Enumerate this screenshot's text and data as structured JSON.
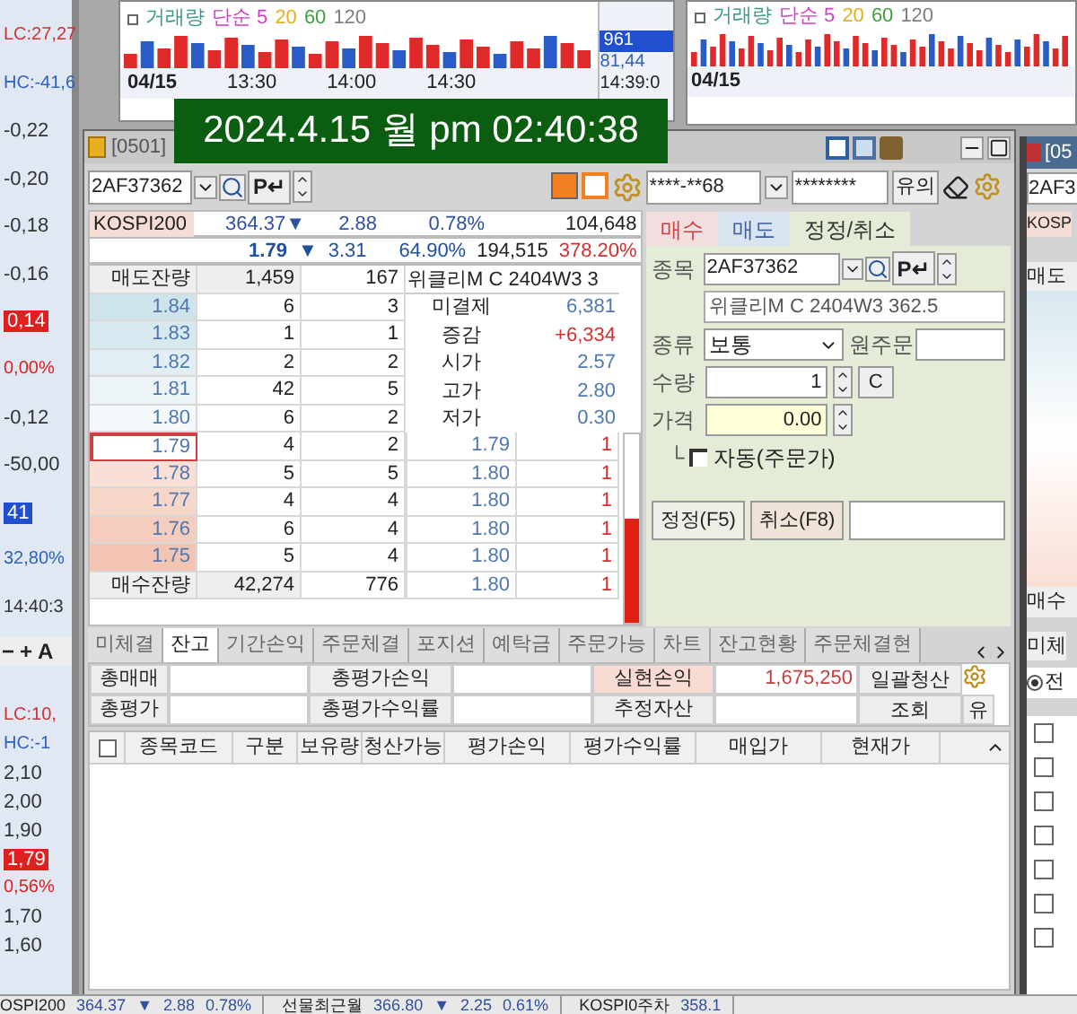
{
  "left_axis": {
    "upper": [
      {
        "text": "LC:27,27",
        "kind": "lc"
      },
      {
        "text": "HC:-41,6",
        "kind": "hc"
      },
      {
        "text": "-0,22",
        "kind": "tick"
      },
      {
        "text": "-0,20",
        "kind": "tick"
      },
      {
        "text": "-0,18",
        "kind": "tick"
      },
      {
        "text": "-0,16",
        "kind": "tick"
      },
      {
        "text": "0,14",
        "kind": "redtag"
      },
      {
        "text": "0,00%",
        "kind": "redpct"
      },
      {
        "text": "-0,12",
        "kind": "tick"
      },
      {
        "text": "-50,00",
        "kind": "tick"
      },
      {
        "text": "41",
        "kind": "bluetag"
      },
      {
        "text": "32,80%",
        "kind": "bluepct"
      },
      {
        "text": "14:40:3",
        "kind": "time"
      }
    ],
    "toolbar": [
      "−",
      "+",
      "A"
    ],
    "lower": [
      {
        "text": "LC:10,",
        "kind": "lc"
      },
      {
        "text": "HC:-1",
        "kind": "hc"
      },
      {
        "text": "2,10",
        "kind": "tick"
      },
      {
        "text": "2,00",
        "kind": "tick"
      },
      {
        "text": "1,90",
        "kind": "tick"
      },
      {
        "text": "1,79",
        "kind": "redtag"
      },
      {
        "text": "0,56%",
        "kind": "redpct"
      },
      {
        "text": "1,70",
        "kind": "tick"
      },
      {
        "text": "1,60",
        "kind": "tick"
      }
    ]
  },
  "chart_left": {
    "legend": [
      {
        "text": "거래량",
        "color": "#3a9a8a"
      },
      {
        "text": "단순 5",
        "color": "#d040c0"
      },
      {
        "text": "20",
        "color": "#e0b020"
      },
      {
        "text": "60",
        "color": "#40a040"
      },
      {
        "text": "120",
        "color": "#808080"
      }
    ],
    "date": "04/15",
    "times": [
      "13:30",
      "14:00",
      "14:30"
    ],
    "axis": {
      "tag": "961",
      "value": "81,44",
      "time": "14:39:0"
    }
  },
  "chart_right": {
    "legend": [
      {
        "text": "거래량",
        "color": "#3a9a8a"
      },
      {
        "text": "단순 5",
        "color": "#d040c0"
      },
      {
        "text": "20",
        "color": "#e0b020"
      },
      {
        "text": "60",
        "color": "#40a040"
      },
      {
        "text": "120",
        "color": "#808080"
      }
    ],
    "date": "04/15"
  },
  "clock": "2024.4.15 월 pm 02:40:38",
  "main_window": {
    "title": "[0501]",
    "code": "2AF37362",
    "p_label": "P↵",
    "index_row": {
      "name": "KOSPI200",
      "value": "364.37",
      "arrow": "▼",
      "change": "2.88",
      "rate": "0.78%",
      "volume": "104,648"
    },
    "price_row": {
      "price": "1.79",
      "arrow": "▼",
      "change": "3.31",
      "rate": "64.90%",
      "volume": "194,515",
      "ratio": "378.20%"
    },
    "ask_header": {
      "label": "매도잔량",
      "qty": "1,459",
      "count": "167",
      "name": "위클리M C 2404W3 3"
    },
    "asks": [
      {
        "price": "1.84",
        "qty": "6",
        "count": "3",
        "label": "미결제",
        "value": "6,381",
        "kind": "plain"
      },
      {
        "price": "1.83",
        "qty": "1",
        "count": "1",
        "label": "증감",
        "value": "+6,334",
        "kind": "up"
      },
      {
        "price": "1.82",
        "qty": "2",
        "count": "2",
        "label": "시가",
        "value": "2.57",
        "kind": "plain"
      },
      {
        "price": "1.81",
        "qty": "42",
        "count": "5",
        "label": "고가",
        "value": "2.80",
        "kind": "plain"
      },
      {
        "price": "1.80",
        "qty": "6",
        "count": "2",
        "label": "저가",
        "value": "0.30",
        "kind": "plain"
      }
    ],
    "bids": [
      {
        "price": "1.79",
        "qty": "4",
        "count": "2",
        "trade_price": "1.79",
        "trade_qty": "1",
        "selected": true
      },
      {
        "price": "1.78",
        "qty": "5",
        "count": "5",
        "trade_price": "1.80",
        "trade_qty": "1",
        "selected": false
      },
      {
        "price": "1.77",
        "qty": "4",
        "count": "4",
        "trade_price": "1.80",
        "trade_qty": "1",
        "selected": false
      },
      {
        "price": "1.76",
        "qty": "6",
        "count": "4",
        "trade_price": "1.80",
        "trade_qty": "1",
        "selected": false
      },
      {
        "price": "1.75",
        "qty": "5",
        "count": "4",
        "trade_price": "1.80",
        "trade_qty": "1",
        "selected": false
      }
    ],
    "bid_footer": {
      "label": "매수잔량",
      "qty": "42,274",
      "count": "776",
      "trade_price": "1.80",
      "trade_qty": "1"
    },
    "strength": {
      "level": 0.55
    },
    "order": {
      "account": "****-**68",
      "password": "********",
      "notice": "유의",
      "tabs": [
        {
          "label": "매수",
          "selected": false,
          "kind": "buy"
        },
        {
          "label": "매도",
          "selected": false,
          "kind": "sell"
        },
        {
          "label": "정정/취소",
          "selected": true,
          "kind": "modify"
        }
      ],
      "symbol_label": "종목",
      "symbol": "2AF37362",
      "p_label": "P↵",
      "symbol_name": "위클리M C 2404W3 362.5",
      "type_label": "종류",
      "type": "보통",
      "orig_label": "원주문",
      "qty_label": "수량",
      "qty": "1",
      "clear": "C",
      "price_label": "가격",
      "price": "0.00",
      "tree": "└",
      "auto": {
        "label": "자동(주문가)",
        "checked": false
      },
      "buttons": [
        {
          "label": "정정(F5)",
          "kind": "modify"
        },
        {
          "label": "취소(F8)",
          "kind": "cancel"
        }
      ]
    },
    "bottom_tabs": [
      {
        "label": "미체결",
        "selected": false
      },
      {
        "label": "잔고",
        "selected": true
      },
      {
        "label": "기간손익",
        "selected": false
      },
      {
        "label": "주문체결",
        "selected": false
      },
      {
        "label": "포지션",
        "selected": false
      },
      {
        "label": "예탁금",
        "selected": false
      },
      {
        "label": "주문가능",
        "selected": false
      },
      {
        "label": "차트",
        "selected": false
      },
      {
        "label": "잔고현황",
        "selected": false
      },
      {
        "label": "주문체결현",
        "selected": false
      }
    ],
    "summary": {
      "row1": [
        {
          "label": "총매매"
        },
        {
          "label": "총평가손익"
        },
        {
          "label": "실현손익",
          "value": "1,675,250"
        }
      ],
      "liquidate": "일괄청산",
      "row2": [
        {
          "label": "총평가"
        },
        {
          "label": "총평가수익률"
        },
        {
          "label": "추정자산"
        }
      ],
      "query": "조회",
      "notice": "유"
    },
    "table": {
      "columns": [
        "종목코드",
        "구분",
        "보유량",
        "청산가능",
        "평가손익",
        "평가수익률",
        "매입가",
        "현재가"
      ],
      "all_checked": false
    }
  },
  "right_window": {
    "title": "[05",
    "code": "2AF3",
    "index": "KOSP",
    "ask_label": "매도",
    "bid_label": "매수",
    "tab": "미체",
    "radio": {
      "label": "전",
      "selected": true
    },
    "rows": [
      {
        "checked": false
      },
      {
        "checked": false
      },
      {
        "checked": false
      },
      {
        "checked": false
      },
      {
        "checked": false
      },
      {
        "checked": false
      },
      {
        "checked": false
      }
    ]
  },
  "status_bar": [
    {
      "name": "OSPI200",
      "value": "364.37",
      "arrow": "▼",
      "change": "2.88",
      "rate": "0.78%"
    },
    {
      "name": "선물최근월",
      "value": "366.80",
      "arrow": "▼",
      "change": "2.25",
      "rate": "0.61%"
    },
    {
      "name": "KOSPI0주차",
      "value": "358.1"
    }
  ]
}
